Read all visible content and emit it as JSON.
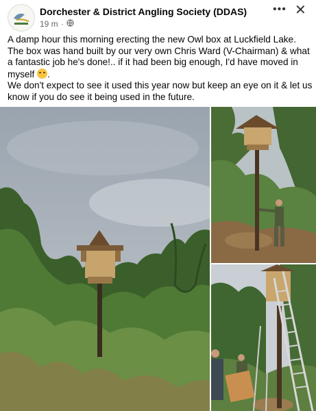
{
  "post": {
    "page_name": "Dorchester & District Angling Society (DDAS)",
    "time": "19 m",
    "separator": "·",
    "privacy_icon": "globe-icon",
    "more_icon": "more-dots-icon",
    "close_icon": "close-icon",
    "avatar_icon": "society-logo-icon",
    "text_line1": "A damp hour this morning erecting the new Owl box at Luckfield Lake. The box was hand built by our very own Chris Ward (V-Chairman) & what a fantastic job he's done!.. if it had been big enough, I'd have moved in myself",
    "text_line1_end": ".",
    "emoji_icon": "grimacing-face-icon",
    "text_line2": "We don't expect to see it used this year now but keep an eye on it & let us know if you do see it being used in the future."
  },
  "photos": [
    {
      "name": "owl-box-on-pole-photo"
    },
    {
      "name": "man-beside-owl-box-pole-photo"
    },
    {
      "name": "ladder-against-owl-box-photo"
    }
  ],
  "colors": {
    "text": "#050505",
    "meta": "#65676b",
    "sky": "#a9b2bc",
    "foliage": "#3f6a2c",
    "wood": "#b08b55"
  }
}
